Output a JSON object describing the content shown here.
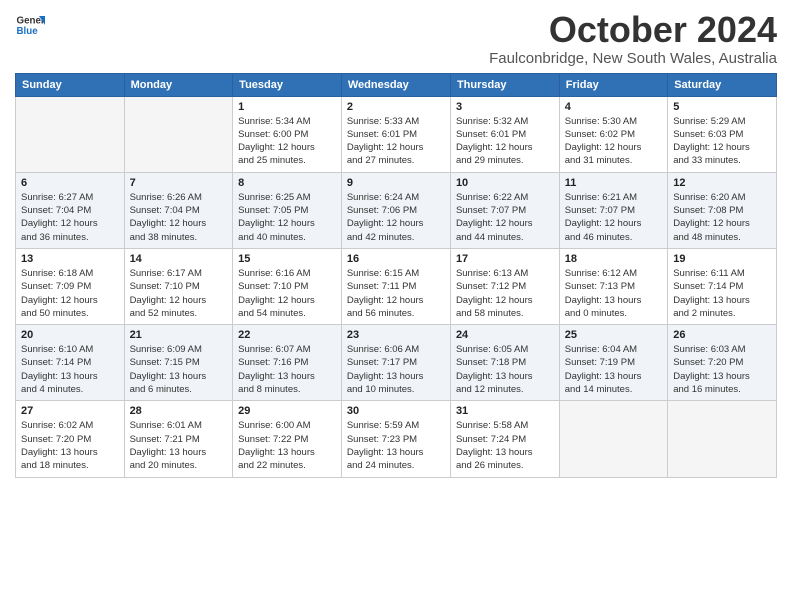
{
  "logo": {
    "line1": "General",
    "line2": "Blue"
  },
  "title": "October 2024",
  "location": "Faulconbridge, New South Wales, Australia",
  "weekdays": [
    "Sunday",
    "Monday",
    "Tuesday",
    "Wednesday",
    "Thursday",
    "Friday",
    "Saturday"
  ],
  "weeks": [
    [
      {
        "day": "",
        "info": ""
      },
      {
        "day": "",
        "info": ""
      },
      {
        "day": "1",
        "info": "Sunrise: 5:34 AM\nSunset: 6:00 PM\nDaylight: 12 hours\nand 25 minutes."
      },
      {
        "day": "2",
        "info": "Sunrise: 5:33 AM\nSunset: 6:01 PM\nDaylight: 12 hours\nand 27 minutes."
      },
      {
        "day": "3",
        "info": "Sunrise: 5:32 AM\nSunset: 6:01 PM\nDaylight: 12 hours\nand 29 minutes."
      },
      {
        "day": "4",
        "info": "Sunrise: 5:30 AM\nSunset: 6:02 PM\nDaylight: 12 hours\nand 31 minutes."
      },
      {
        "day": "5",
        "info": "Sunrise: 5:29 AM\nSunset: 6:03 PM\nDaylight: 12 hours\nand 33 minutes."
      }
    ],
    [
      {
        "day": "6",
        "info": "Sunrise: 6:27 AM\nSunset: 7:04 PM\nDaylight: 12 hours\nand 36 minutes."
      },
      {
        "day": "7",
        "info": "Sunrise: 6:26 AM\nSunset: 7:04 PM\nDaylight: 12 hours\nand 38 minutes."
      },
      {
        "day": "8",
        "info": "Sunrise: 6:25 AM\nSunset: 7:05 PM\nDaylight: 12 hours\nand 40 minutes."
      },
      {
        "day": "9",
        "info": "Sunrise: 6:24 AM\nSunset: 7:06 PM\nDaylight: 12 hours\nand 42 minutes."
      },
      {
        "day": "10",
        "info": "Sunrise: 6:22 AM\nSunset: 7:07 PM\nDaylight: 12 hours\nand 44 minutes."
      },
      {
        "day": "11",
        "info": "Sunrise: 6:21 AM\nSunset: 7:07 PM\nDaylight: 12 hours\nand 46 minutes."
      },
      {
        "day": "12",
        "info": "Sunrise: 6:20 AM\nSunset: 7:08 PM\nDaylight: 12 hours\nand 48 minutes."
      }
    ],
    [
      {
        "day": "13",
        "info": "Sunrise: 6:18 AM\nSunset: 7:09 PM\nDaylight: 12 hours\nand 50 minutes."
      },
      {
        "day": "14",
        "info": "Sunrise: 6:17 AM\nSunset: 7:10 PM\nDaylight: 12 hours\nand 52 minutes."
      },
      {
        "day": "15",
        "info": "Sunrise: 6:16 AM\nSunset: 7:10 PM\nDaylight: 12 hours\nand 54 minutes."
      },
      {
        "day": "16",
        "info": "Sunrise: 6:15 AM\nSunset: 7:11 PM\nDaylight: 12 hours\nand 56 minutes."
      },
      {
        "day": "17",
        "info": "Sunrise: 6:13 AM\nSunset: 7:12 PM\nDaylight: 12 hours\nand 58 minutes."
      },
      {
        "day": "18",
        "info": "Sunrise: 6:12 AM\nSunset: 7:13 PM\nDaylight: 13 hours\nand 0 minutes."
      },
      {
        "day": "19",
        "info": "Sunrise: 6:11 AM\nSunset: 7:14 PM\nDaylight: 13 hours\nand 2 minutes."
      }
    ],
    [
      {
        "day": "20",
        "info": "Sunrise: 6:10 AM\nSunset: 7:14 PM\nDaylight: 13 hours\nand 4 minutes."
      },
      {
        "day": "21",
        "info": "Sunrise: 6:09 AM\nSunset: 7:15 PM\nDaylight: 13 hours\nand 6 minutes."
      },
      {
        "day": "22",
        "info": "Sunrise: 6:07 AM\nSunset: 7:16 PM\nDaylight: 13 hours\nand 8 minutes."
      },
      {
        "day": "23",
        "info": "Sunrise: 6:06 AM\nSunset: 7:17 PM\nDaylight: 13 hours\nand 10 minutes."
      },
      {
        "day": "24",
        "info": "Sunrise: 6:05 AM\nSunset: 7:18 PM\nDaylight: 13 hours\nand 12 minutes."
      },
      {
        "day": "25",
        "info": "Sunrise: 6:04 AM\nSunset: 7:19 PM\nDaylight: 13 hours\nand 14 minutes."
      },
      {
        "day": "26",
        "info": "Sunrise: 6:03 AM\nSunset: 7:20 PM\nDaylight: 13 hours\nand 16 minutes."
      }
    ],
    [
      {
        "day": "27",
        "info": "Sunrise: 6:02 AM\nSunset: 7:20 PM\nDaylight: 13 hours\nand 18 minutes."
      },
      {
        "day": "28",
        "info": "Sunrise: 6:01 AM\nSunset: 7:21 PM\nDaylight: 13 hours\nand 20 minutes."
      },
      {
        "day": "29",
        "info": "Sunrise: 6:00 AM\nSunset: 7:22 PM\nDaylight: 13 hours\nand 22 minutes."
      },
      {
        "day": "30",
        "info": "Sunrise: 5:59 AM\nSunset: 7:23 PM\nDaylight: 13 hours\nand 24 minutes."
      },
      {
        "day": "31",
        "info": "Sunrise: 5:58 AM\nSunset: 7:24 PM\nDaylight: 13 hours\nand 26 minutes."
      },
      {
        "day": "",
        "info": ""
      },
      {
        "day": "",
        "info": ""
      }
    ]
  ]
}
